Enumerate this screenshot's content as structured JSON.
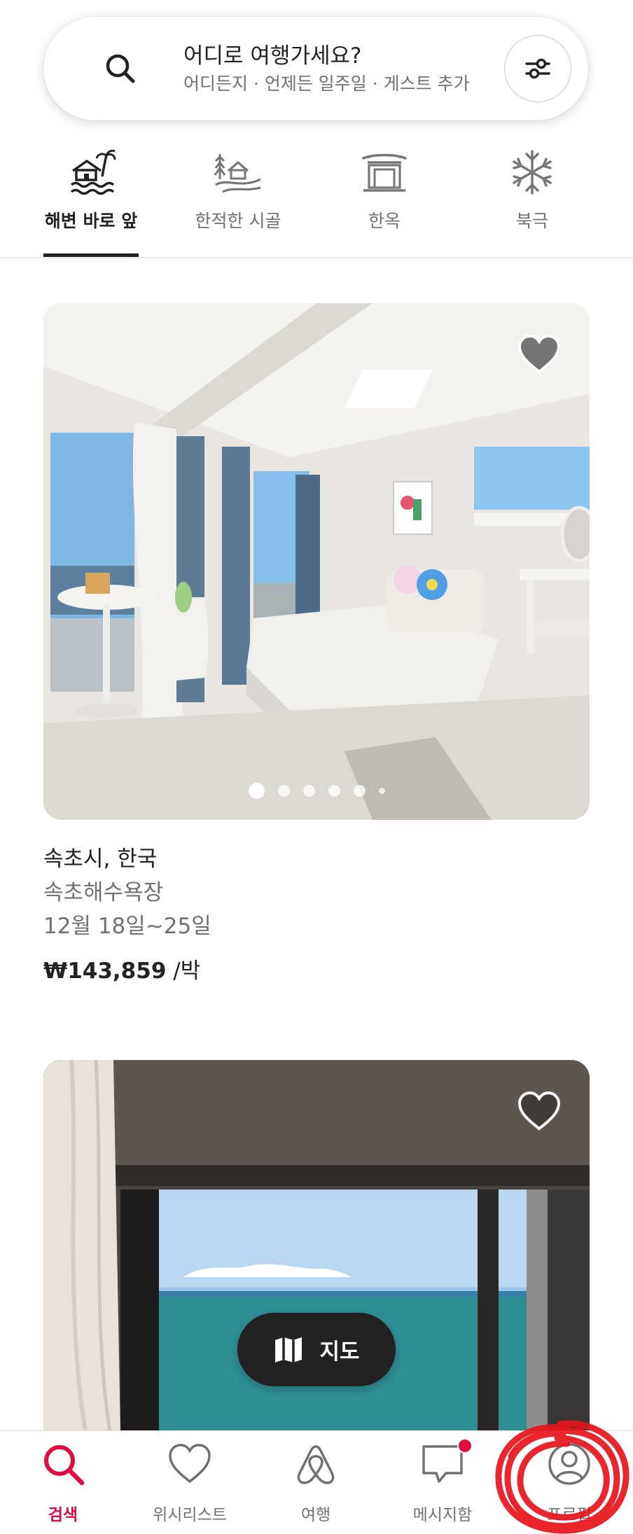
{
  "search": {
    "title": "어디로 여행가세요?",
    "subtitle": "어디든지 · 언제든 일주일 · 게스트 추가"
  },
  "categories": [
    {
      "label": "해변 바로 앞",
      "icon": "beachfront-icon",
      "active": true
    },
    {
      "label": "한적한 시골",
      "icon": "countryside-icon",
      "active": false
    },
    {
      "label": "한옥",
      "icon": "hanok-icon",
      "active": false
    },
    {
      "label": "북극",
      "icon": "arctic-icon",
      "active": false
    }
  ],
  "listings": [
    {
      "location": "속초시, 한국",
      "name": "속초해수욕장",
      "dates": "12월 18일~25일",
      "price": "₩143,859",
      "price_unit": "/박",
      "photo_index": 1,
      "photo_count": 6,
      "favorited": true
    },
    {
      "favorited": false
    }
  ],
  "map_button": {
    "label": "지도",
    "icon": "map-icon"
  },
  "bottom_nav": [
    {
      "label": "검색",
      "icon": "search-icon",
      "active": true
    },
    {
      "label": "위시리스트",
      "icon": "heart-icon",
      "active": false
    },
    {
      "label": "여행",
      "icon": "airbnb-icon",
      "active": false
    },
    {
      "label": "메시지함",
      "icon": "message-icon",
      "active": false,
      "badge": true
    },
    {
      "label": "프로필",
      "icon": "profile-icon",
      "active": false
    }
  ],
  "colors": {
    "accent": "#e00b41",
    "text": "#222222",
    "secondary_text": "#717171",
    "annotation": "#e8141c"
  }
}
